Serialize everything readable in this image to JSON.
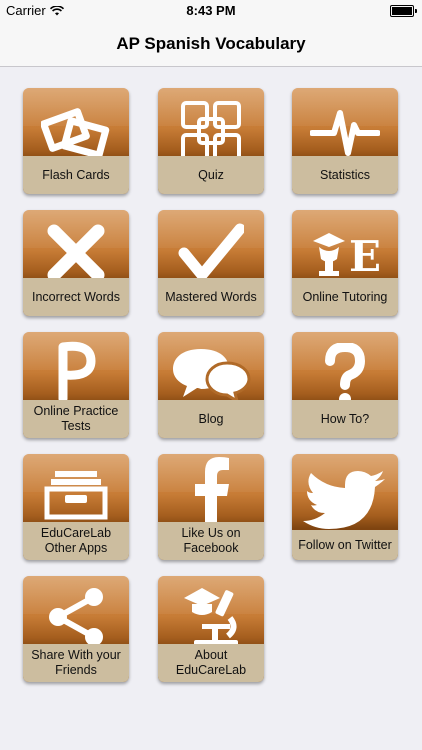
{
  "status_bar": {
    "carrier": "Carrier",
    "time": "8:43 PM"
  },
  "nav": {
    "title": "AP Spanish Vocabulary"
  },
  "colors": {
    "tile_top": "#d28c48",
    "tile_bottom": "#7f4410",
    "label_bar": "#ccbd9f",
    "background": "#efeff4"
  },
  "tiles": [
    {
      "label": "Flash Cards",
      "icon": "flash-cards-icon"
    },
    {
      "label": "Quiz",
      "icon": "quiz-icon"
    },
    {
      "label": "Statistics",
      "icon": "statistics-icon"
    },
    {
      "label": "Incorrect Words",
      "icon": "x-icon"
    },
    {
      "label": "Mastered Words",
      "icon": "checkmark-icon"
    },
    {
      "label": "Online Tutoring",
      "icon": "tutoring-icon"
    },
    {
      "label": "Online Practice Tests",
      "icon": "practice-p-icon"
    },
    {
      "label": "Blog",
      "icon": "speech-bubbles-icon"
    },
    {
      "label": "How To?",
      "icon": "question-mark-icon"
    },
    {
      "label": "EduCareLab Other Apps",
      "icon": "file-drawer-icon"
    },
    {
      "label": "Like Us on Facebook",
      "icon": "facebook-icon"
    },
    {
      "label": "Follow on Twitter",
      "icon": "twitter-bird-icon"
    },
    {
      "label": "Share With your Friends",
      "icon": "share-icon"
    },
    {
      "label": "About EduCareLab",
      "icon": "microscope-icon"
    }
  ]
}
